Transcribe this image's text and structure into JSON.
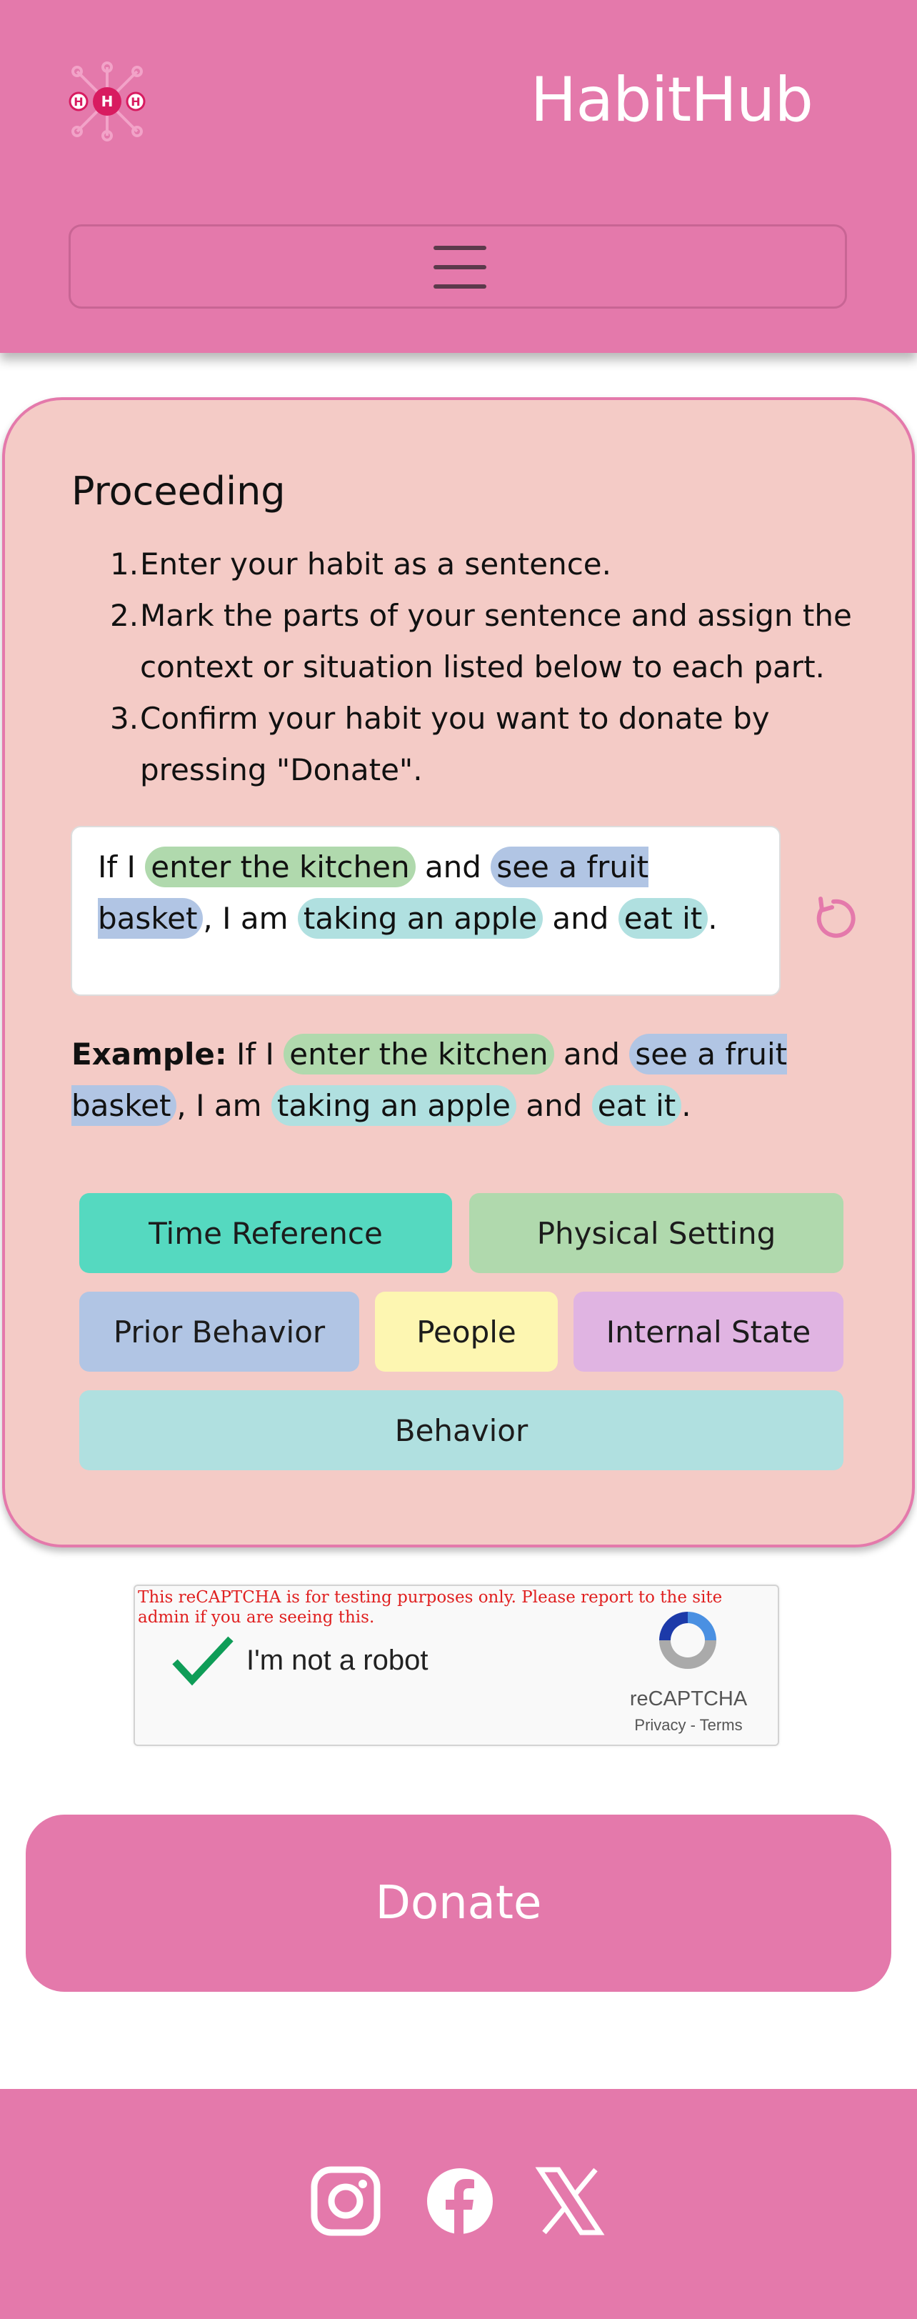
{
  "header": {
    "brand": "HabitHub",
    "logo_letters": [
      "H",
      "H",
      "H"
    ]
  },
  "proceeding": {
    "title": "Proceeding",
    "steps": [
      {
        "num": "1.",
        "text": "Enter your habit as a sentence."
      },
      {
        "num": "2.",
        "text": "Mark the parts of your sentence and assign the context or situation listed below to each part."
      },
      {
        "num": "3.",
        "text": "Confirm your habit you want to donate by pressing \"Donate\"."
      }
    ]
  },
  "sentence": {
    "t1": "If I",
    "chip1": "enter the kitchen",
    "t2": "and",
    "chip2": "see a fruit basket",
    "t3": ", I am",
    "chip3": "taking an apple",
    "t4": "and",
    "chip4": "eat it",
    "t5": "."
  },
  "example": {
    "label": "Example:",
    "t1": "If I",
    "chip1": "enter the kitchen",
    "t2": "and",
    "chip2": "see a fruit basket",
    "t3": ", I am",
    "chip3": "taking an apple",
    "t4": "and",
    "chip4": "eat it",
    "t5": "."
  },
  "categories": [
    {
      "label": "Time Reference",
      "color": "#55d9c0"
    },
    {
      "label": "Physical Setting",
      "color": "#b0d9ad"
    },
    {
      "label": "Prior Behavior",
      "color": "#b1c5e4"
    },
    {
      "label": "People",
      "color": "#fdf6b1"
    },
    {
      "label": "Internal State",
      "color": "#e0b4e2"
    },
    {
      "label": "Behavior",
      "color": "#b0e0e0"
    }
  ],
  "recaptcha": {
    "warning": "This reCAPTCHA is for testing purposes only. Please report to the site admin if you are seeing this.",
    "label": "I'm not a robot",
    "brand": "reCAPTCHA",
    "links": "Privacy - Terms"
  },
  "donate": {
    "label": "Donate"
  },
  "colors": {
    "primary": "#e479ab",
    "card_bg": "#f4cbc6"
  },
  "footer": {
    "icons": [
      "instagram-icon",
      "facebook-icon",
      "x-icon"
    ]
  }
}
